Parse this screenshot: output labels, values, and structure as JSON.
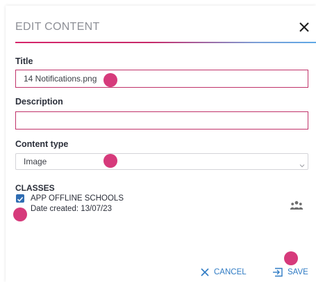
{
  "dialog": {
    "title": "EDIT CONTENT",
    "close_icon": "close-icon"
  },
  "form": {
    "title_label": "Title",
    "title_value": "14 Notifications.png",
    "description_label": "Description",
    "description_value": "",
    "content_type_label": "Content type",
    "content_type_value": "Image"
  },
  "classes": {
    "heading": "CLASSES",
    "items": [
      {
        "name": "APP OFFLINE SCHOOLS",
        "date_created": "Date created: 13/07/23",
        "checked": true,
        "icon": "group-icon"
      }
    ]
  },
  "actions": {
    "cancel_label": "CANCEL",
    "save_label": "SAVE"
  },
  "colors": {
    "accent_pink": "#d6266b",
    "accent_blue": "#2f7bc4",
    "marker": "#d63a7b"
  }
}
